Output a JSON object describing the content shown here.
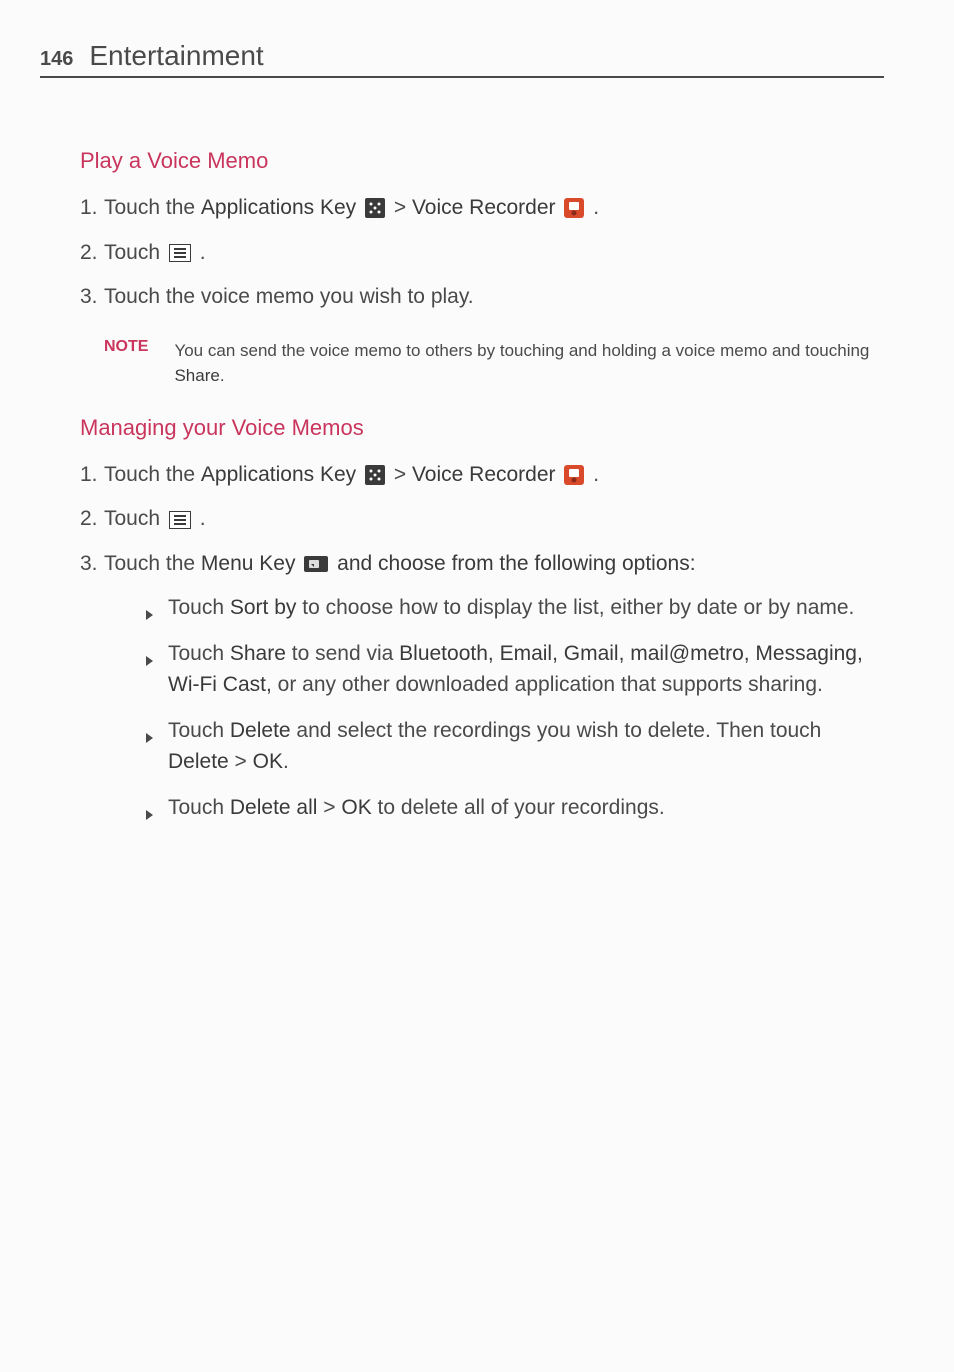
{
  "header": {
    "page_number": "146",
    "chapter": "Entertainment"
  },
  "section1": {
    "title": "Play a Voice Memo",
    "steps": {
      "s1": {
        "num": "1.",
        "a": "Touch the ",
        "b": "Applications Key ",
        "c": " > ",
        "d": "Voice Recorder ",
        "e": "."
      },
      "s2": {
        "num": "2.",
        "a": "Touch ",
        "b": "."
      },
      "s3": {
        "num": "3.",
        "a": "Touch the voice memo you wish to play."
      }
    },
    "note": {
      "label": "NOTE",
      "a": "You can send the voice memo to others by touching and holding a voice memo and touching ",
      "b": "Share",
      "c": "."
    }
  },
  "section2": {
    "title": "Managing your Voice Memos",
    "steps": {
      "s1": {
        "num": "1.",
        "a": "Touch the ",
        "b": "Applications Key ",
        "c": " > ",
        "d": "Voice Recorder ",
        "e": "."
      },
      "s2": {
        "num": "2.",
        "a": "Touch ",
        "b": "."
      },
      "s3": {
        "num": "3.",
        "a": "Touch the ",
        "b": "Menu Key ",
        "c": " and choose from the following options:"
      }
    },
    "bullets": {
      "b1": {
        "a": "Touch ",
        "b": "Sort by",
        "c": " to choose how to display the list, either by date or by name."
      },
      "b2": {
        "a": "Touch ",
        "b": "Share",
        "c": " to send via ",
        "d": "Bluetooth, Email, Gmail, mail@metro, Messaging, Wi-Fi Cast,",
        "e": " or any other downloaded application that supports sharing."
      },
      "b3": {
        "a": "Touch ",
        "b": "Delete",
        "c": " and select the recordings you wish to delete. Then touch ",
        "d": "Delete",
        "e": " > ",
        "f": "OK",
        "g": "."
      },
      "b4": {
        "a": "Touch ",
        "b": "Delete all",
        "c": " > ",
        "d": "OK",
        "e": " to delete all of your recordings."
      }
    }
  }
}
